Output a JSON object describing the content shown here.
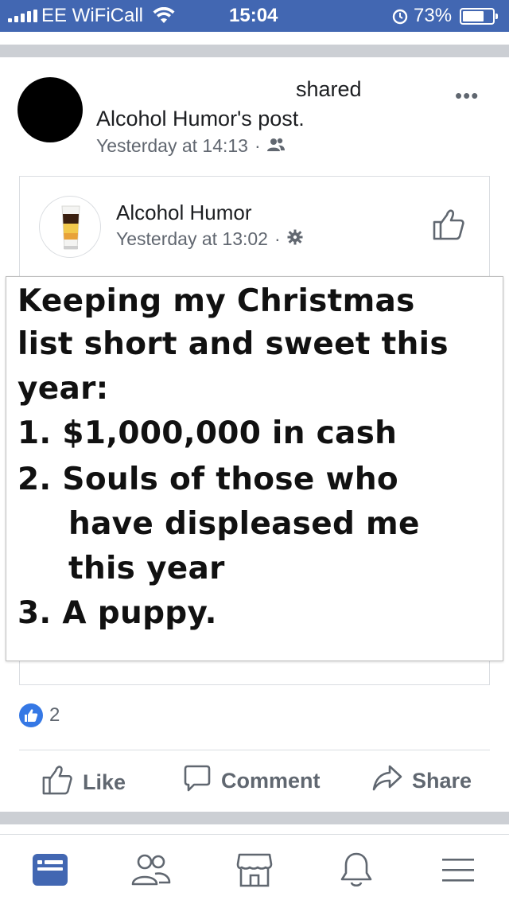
{
  "status_bar": {
    "carrier": "EE WiFiCall",
    "time": "15:04",
    "battery": "73%",
    "battery_level": 0.73
  },
  "post": {
    "shared_word": "shared",
    "shared_target": "Alcohol Humor's post.",
    "timestamp": "Yesterday at 14:13",
    "separator": "·",
    "audience_icon": "friends-icon",
    "more_label": "•••"
  },
  "embedded_post": {
    "page_name": "Alcohol Humor",
    "timestamp": "Yesterday at 13:02",
    "separator": "·",
    "audience_icon": "gear-icon",
    "image_text": [
      "Keeping my Christmas",
      "list short and sweet this",
      "year:",
      "1. $1,000,000 in cash",
      "2. Souls of those who",
      "have displeased me",
      "this year",
      "3. A puppy."
    ]
  },
  "reactions": {
    "count": "2",
    "icon": "like-badge-icon"
  },
  "actions": {
    "like": "Like",
    "comment": "Comment",
    "share": "Share"
  },
  "bottom_nav": [
    "news-feed-icon",
    "friends-icon",
    "marketplace-icon",
    "notifications-icon",
    "menu-icon"
  ],
  "colors": {
    "brand_blue": "#4267b2",
    "like_blue": "#3578e5",
    "meta_gray": "#616770",
    "band_gray": "#cccfd4"
  }
}
